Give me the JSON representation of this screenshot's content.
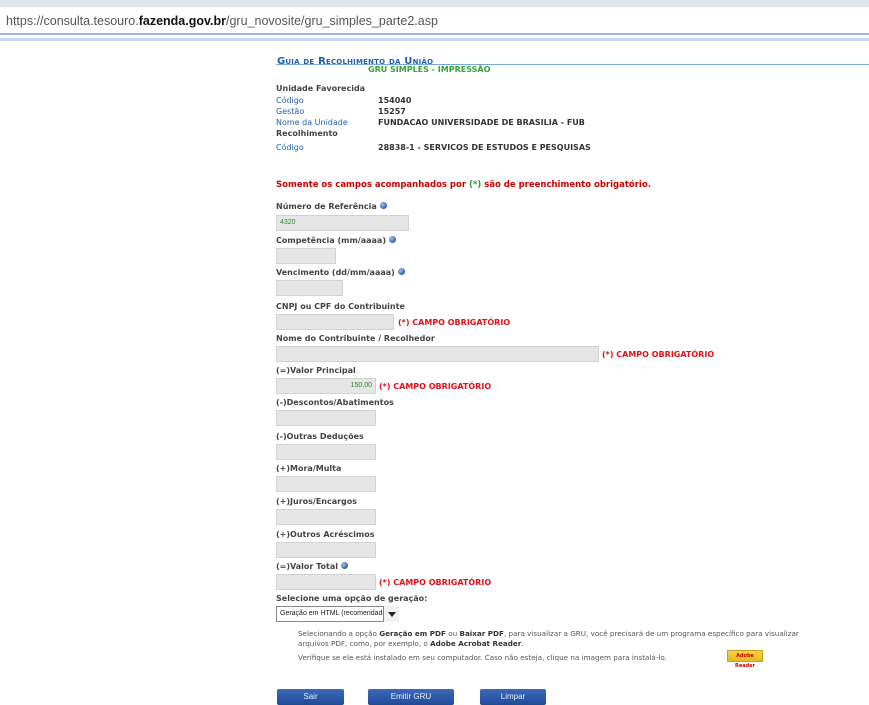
{
  "browser": {
    "url_prefix": "https://consulta.tesouro.",
    "url_domain": "fazenda.gov.br",
    "url_path": "/gru_novosite/gru_simples_parte2.asp"
  },
  "header": {
    "title": "Guia de Recolhimento da União",
    "subtitle": "GRU SIMPLES - IMPRESSÃO"
  },
  "unidade": {
    "section_label": "Unidade Favorecida",
    "codigo_label": "Código",
    "codigo_value": "154040",
    "gestao_label": "Gestão",
    "gestao_value": "15257",
    "nome_label": "Nome da Unidade",
    "nome_value": "FUNDACAO UNIVERSIDADE DE BRASILIA - FUB"
  },
  "recolhimento": {
    "section_label": "Recolhimento",
    "codigo_label": "Código",
    "codigo_value": "28838-1 - SERVICOS DE ESTUDOS E PESQUISAS"
  },
  "warning": {
    "pre": "Somente os campos acompanhados por ",
    "mark": "(*)",
    "post": " são de preenchimento obrigatório."
  },
  "required_text": "(*) CAMPO OBRIGATÓRIO",
  "fields": {
    "numero_referencia": {
      "label": "Número de Referência",
      "value": "4320"
    },
    "competencia": {
      "label": "Competência (mm/aaaa)",
      "value": ""
    },
    "vencimento": {
      "label": "Vencimento (dd/mm/aaaa)",
      "value": ""
    },
    "cnpj_cpf": {
      "label": "CNPJ ou CPF do Contribuinte",
      "value": ""
    },
    "nome_contribuinte": {
      "label": "Nome do Contribuinte / Recolhedor",
      "value": ""
    },
    "valor_principal": {
      "label": "(=)Valor Principal",
      "value": "150,00"
    },
    "descontos": {
      "label": "(-)Descontos/Abatimentos",
      "value": ""
    },
    "outras_deducoes": {
      "label": "(-)Outras Deduções",
      "value": ""
    },
    "mora_multa": {
      "label": "(+)Mora/Multa",
      "value": ""
    },
    "juros_encargos": {
      "label": "(+)Juros/Encargos",
      "value": ""
    },
    "outros_acrescimos": {
      "label": "(+)Outros Acréscimos",
      "value": ""
    },
    "valor_total": {
      "label": "(=)Valor Total",
      "value": ""
    }
  },
  "geracao": {
    "label": "Selecione uma opção de geração:",
    "selected": "Geração em HTML (recomendada)"
  },
  "notes": {
    "line1_a": "Selecionando a opção ",
    "line1_b": "Geração em PDF",
    "line1_c": " ou ",
    "line1_d": "Baixar PDF",
    "line1_e": ", para visualizar a GRU, você precisará de um programa específico para visualizar",
    "line2_a": "arquivos PDF, como, por exemplo, o ",
    "line2_b": "Adobe Acrobat Reader",
    "line2_c": ".",
    "line3": "Verifique se ele está instalado em seu computador. Caso não esteja, clique na imagem para instalá-lo.",
    "adobe_badge": "Adobe Reader"
  },
  "buttons": {
    "sair": "Sair",
    "emitir": "Emitir GRU",
    "limpar": "Limpar"
  }
}
